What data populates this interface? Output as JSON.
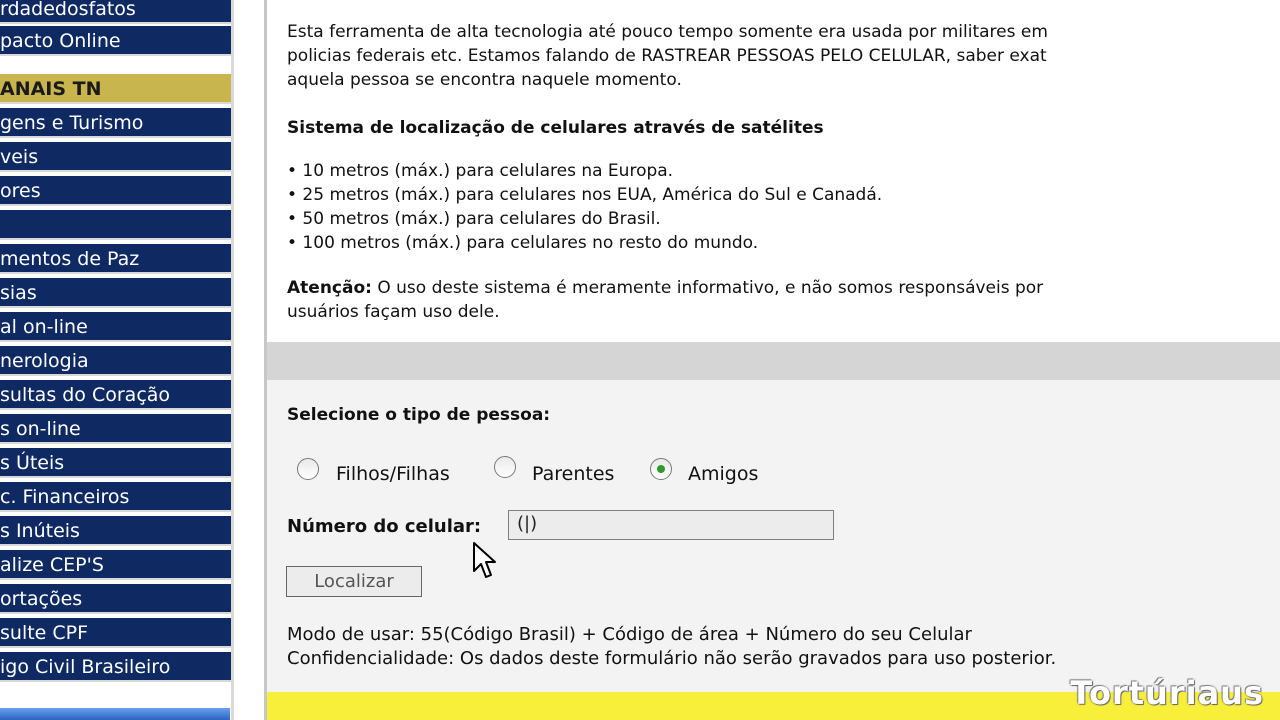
{
  "sidebar": {
    "items_top": [
      "rdadedosfatos",
      "pacto Online"
    ],
    "header": "ANAIS TN",
    "items": [
      "gens e Turismo",
      "veis",
      "ores",
      "",
      "mentos de Paz",
      "sias",
      "al on-line",
      "nerologia",
      "sultas do Coração",
      "s on-line",
      "s Úteis",
      "c. Financeiros",
      "s Inúteis",
      "alize CEP'S",
      "ortações",
      "sulte CPF",
      "igo Civil Brasileiro"
    ]
  },
  "intro": {
    "line1": "Esta ferramenta de alta tecnologia até pouco tempo somente era usada por militares em",
    "line2": "policias federais etc. Estamos falando de RASTREAR PESSOAS PELO CELULAR, saber exat",
    "line3": "aquela pessoa se encontra naquele momento."
  },
  "system": {
    "title": "Sistema de localização de celulares através de satélites",
    "bullets": [
      "• 10 metros (máx.) para celulares na Europa.",
      "• 25 metros (máx.) para celulares nos EUA, América do Sul e Canadá.",
      "• 50 metros (máx.) para celulares do Brasil.",
      "• 100 metros (máx.) para celulares no resto do mundo."
    ]
  },
  "warning": {
    "label": "Atenção:",
    "text1": " O uso deste sistema é meramente informativo, e não somos responsáveis por",
    "text2": "usuários façam uso dele."
  },
  "form": {
    "select_label": "Selecione o tipo de pessoa:",
    "options": [
      "Filhos/Filhas",
      "Parentes",
      "Amigos"
    ],
    "selected": "Amigos",
    "phone_label": "Número do celular:",
    "phone_value": "(|)",
    "submit_label": "Localizar",
    "usage": "Modo de usar: 55(Código Brasil) + Código de área + Número do seu Celular",
    "privacy": "Confidencialidade: Os dados deste formulário não serão gravados para uso posterior."
  },
  "watermark": "Tortúriaus",
  "colors": {
    "nav_bg": "#0f2a63",
    "nav_header_bg": "#c8b54e",
    "form_bg": "#f3f3f3",
    "bottom_strip": "#f7ef3a",
    "radio_checked": "#2d9a2d"
  }
}
